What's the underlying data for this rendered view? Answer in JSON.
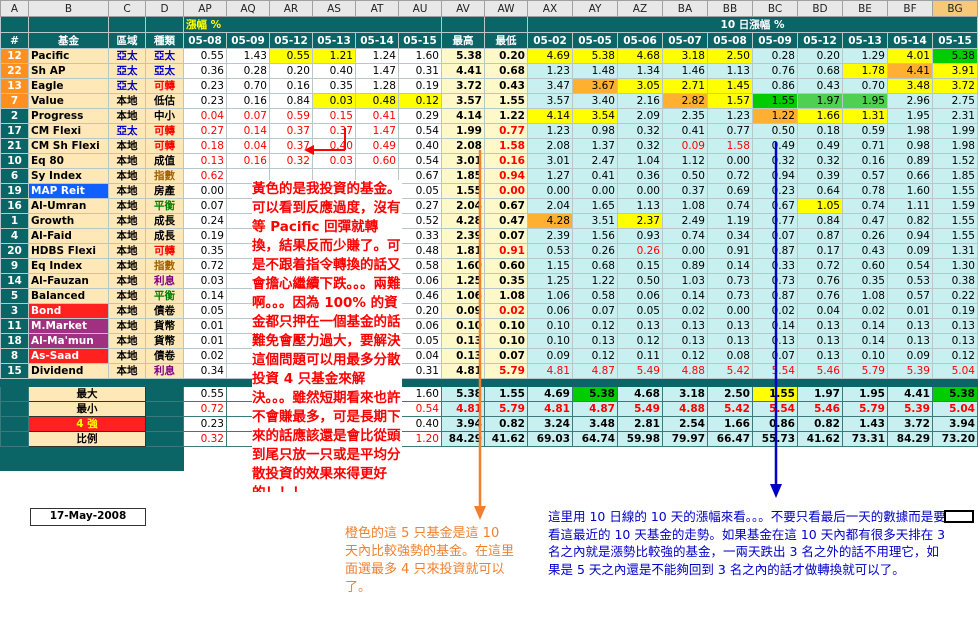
{
  "column_letters": [
    "A",
    "B",
    "C",
    "D",
    "AP",
    "AQ",
    "AR",
    "AS",
    "AT",
    "AU",
    "AV",
    "AW",
    "AX",
    "AY",
    "AZ",
    "BA",
    "BB",
    "BC",
    "BD",
    "BE",
    "BF",
    "BG"
  ],
  "header": {
    "change_label": "漲幅 %",
    "ten_day_label": "10 日漲幅 %",
    "row2": [
      "#",
      "基金",
      "區域",
      "種類",
      "05-08",
      "05-09",
      "05-12",
      "05-13",
      "05-14",
      "05-15",
      "最高",
      "最低",
      "05-02",
      "05-05",
      "05-06",
      "05-07",
      "05-08",
      "05-09",
      "05-12",
      "05-13",
      "05-14",
      "05-15"
    ]
  },
  "rows": [
    {
      "idx": "12",
      "name": "Pacific",
      "region": "亞太",
      "category": "亞太",
      "d": [
        "0.55",
        "1.43",
        "0.55",
        "1.21",
        "1.24",
        "1.60"
      ],
      "max": "5.38",
      "min": "0.20",
      "t": [
        "4.69",
        "5.38",
        "4.68",
        "3.18",
        "2.50",
        "0.28",
        "0.20",
        "1.29",
        "4.01",
        "5.38"
      ]
    },
    {
      "idx": "22",
      "name": "Sh AP",
      "region": "亞太",
      "category": "亞太",
      "d": [
        "0.36",
        "0.28",
        "0.20",
        "0.40",
        "1.47",
        "0.31"
      ],
      "max": "4.41",
      "min": "0.68",
      "t": [
        "1.23",
        "1.48",
        "1.34",
        "1.46",
        "1.13",
        "0.76",
        "0.68",
        "1.78",
        "4.41",
        "3.91"
      ]
    },
    {
      "idx": "13",
      "name": "Eagle",
      "region": "亞太",
      "category": "可轉",
      "d": [
        "0.23",
        "0.70",
        "0.16",
        "0.35",
        "1.28",
        "0.19"
      ],
      "max": "3.72",
      "min": "0.43",
      "t": [
        "3.47",
        "3.67",
        "3.05",
        "2.71",
        "1.45",
        "0.86",
        "0.43",
        "0.70",
        "3.48",
        "3.72"
      ]
    },
    {
      "idx": "7",
      "name": "Value",
      "region": "本地",
      "category": "低估",
      "d": [
        "0.23",
        "0.16",
        "0.84",
        "0.03",
        "0.48",
        "0.12"
      ],
      "max": "3.57",
      "min": "1.55",
      "t": [
        "3.57",
        "3.40",
        "2.16",
        "2.82",
        "1.57",
        "1.55",
        "1.97",
        "1.95",
        "2.96",
        "2.75"
      ]
    },
    {
      "idx": "2",
      "name": "Progress",
      "region": "本地",
      "category": "中小",
      "d": [
        "0.04",
        "0.07",
        "0.59",
        "0.15",
        "0.41",
        "0.29"
      ],
      "max": "4.14",
      "min": "1.22",
      "t": [
        "4.14",
        "3.54",
        "2.09",
        "2.35",
        "1.23",
        "1.22",
        "1.66",
        "1.31",
        "1.95",
        "2.31"
      ]
    },
    {
      "idx": "17",
      "name": "CM Flexi",
      "region": "亞太",
      "category": "可轉",
      "d": [
        "0.27",
        "0.14",
        "0.37",
        "0.37",
        "1.47",
        "0.54"
      ],
      "max": "1.99",
      "min": "0.77",
      "t": [
        "1.23",
        "0.98",
        "0.32",
        "0.41",
        "0.77",
        "0.50",
        "0.18",
        "0.59",
        "1.98",
        "1.99"
      ]
    },
    {
      "idx": "21",
      "name": "CM Sh Flexi",
      "region": "本地",
      "category": "可轉",
      "d": [
        "0.18",
        "0.04",
        "0.37",
        "0.40",
        "0.49",
        "0.40"
      ],
      "max": "2.08",
      "min": "1.58",
      "t": [
        "2.08",
        "1.37",
        "0.32",
        "0.09",
        "1.58",
        "0.49",
        "0.49",
        "0.71",
        "0.98",
        "1.98"
      ]
    },
    {
      "idx": "10",
      "name": "Eq 80",
      "region": "本地",
      "category": "成值",
      "d": [
        "0.13",
        "0.16",
        "0.32",
        "0.03",
        "0.60",
        "0.54"
      ],
      "max": "3.01",
      "min": "0.16",
      "t": [
        "3.01",
        "2.47",
        "1.04",
        "1.12",
        "0.00",
        "0.32",
        "0.32",
        "0.16",
        "0.89",
        "1.52"
      ]
    },
    {
      "idx": "6",
      "name": "Sy Index",
      "region": "本地",
      "category": "指數",
      "d": [
        "0.62",
        "",
        "",
        "",
        "",
        "0.67"
      ],
      "max": "1.85",
      "min": "0.94",
      "t": [
        "1.27",
        "0.41",
        "0.36",
        "0.50",
        "0.72",
        "0.94",
        "0.39",
        "0.57",
        "0.66",
        "1.85"
      ]
    },
    {
      "idx": "19",
      "name": "MAP Reit",
      "region": "本地",
      "category": "房產",
      "d": [
        "0.00",
        "",
        "",
        "",
        "",
        "0.05"
      ],
      "max": "1.55",
      "min": "0.00",
      "t": [
        "0.00",
        "0.00",
        "0.00",
        "0.37",
        "0.69",
        "0.23",
        "0.64",
        "0.78",
        "1.60",
        "1.55"
      ]
    },
    {
      "idx": "16",
      "name": "Al-Umran",
      "region": "本地",
      "category": "平衡",
      "d": [
        "0.07",
        "",
        "",
        "",
        "",
        "0.27"
      ],
      "max": "2.04",
      "min": "0.67",
      "t": [
        "2.04",
        "1.65",
        "1.13",
        "1.08",
        "0.74",
        "0.67",
        "1.05",
        "0.74",
        "1.11",
        "1.59"
      ]
    },
    {
      "idx": "1",
      "name": "Growth",
      "region": "本地",
      "category": "成長",
      "d": [
        "0.24",
        "",
        "",
        "",
        "",
        "0.52"
      ],
      "max": "4.28",
      "min": "0.47",
      "t": [
        "4.28",
        "3.51",
        "2.37",
        "2.49",
        "1.19",
        "0.77",
        "0.84",
        "0.47",
        "0.82",
        "1.55"
      ]
    },
    {
      "idx": "4",
      "name": "Al-Faid",
      "region": "本地",
      "category": "成長",
      "d": [
        "0.19",
        "",
        "",
        "",
        "",
        "0.33"
      ],
      "max": "2.39",
      "min": "0.07",
      "t": [
        "2.39",
        "1.56",
        "0.93",
        "0.74",
        "0.34",
        "0.07",
        "0.87",
        "0.26",
        "0.94",
        "1.55"
      ]
    },
    {
      "idx": "20",
      "name": "HDBS Flexi",
      "region": "本地",
      "category": "可轉",
      "d": [
        "0.35",
        "",
        "",
        "",
        "",
        "0.48"
      ],
      "max": "1.81",
      "min": "0.91",
      "t": [
        "0.53",
        "0.26",
        "0.26",
        "0.00",
        "0.91",
        "0.87",
        "0.17",
        "0.43",
        "0.09",
        "1.31"
      ]
    },
    {
      "idx": "9",
      "name": "Eq Index",
      "region": "本地",
      "category": "指數",
      "d": [
        "0.72",
        "",
        "",
        "",
        "",
        "0.58"
      ],
      "max": "1.60",
      "min": "0.60",
      "t": [
        "1.15",
        "0.68",
        "0.15",
        "0.89",
        "0.14",
        "0.33",
        "0.72",
        "0.60",
        "0.54",
        "1.30"
      ]
    },
    {
      "idx": "14",
      "name": "Al-Fauzan",
      "region": "本地",
      "category": "利息",
      "d": [
        "0.03",
        "",
        "",
        "",
        "",
        "0.06"
      ],
      "max": "1.25",
      "min": "0.35",
      "t": [
        "1.25",
        "1.22",
        "0.50",
        "1.03",
        "0.73",
        "0.73",
        "0.76",
        "0.35",
        "0.53",
        "0.38"
      ]
    },
    {
      "idx": "5",
      "name": "Balanced",
      "region": "本地",
      "category": "平衡",
      "d": [
        "0.14",
        "",
        "",
        "",
        "",
        "0.46"
      ],
      "max": "1.06",
      "min": "1.08",
      "t": [
        "1.06",
        "0.58",
        "0.06",
        "0.14",
        "0.73",
        "0.87",
        "0.76",
        "1.08",
        "0.57",
        "0.22"
      ]
    },
    {
      "idx": "3",
      "name": "Bond",
      "region": "本地",
      "category": "債卷",
      "d": [
        "0.05",
        "",
        "",
        "",
        "",
        "0.20"
      ],
      "max": "0.09",
      "min": "0.02",
      "t": [
        "0.06",
        "0.07",
        "0.05",
        "0.02",
        "0.00",
        "0.02",
        "0.04",
        "0.02",
        "0.01",
        "0.19"
      ]
    },
    {
      "idx": "11",
      "name": "M.Market",
      "region": "本地",
      "category": "貨幣",
      "d": [
        "0.01",
        "",
        "",
        "",
        "",
        "0.06"
      ],
      "max": "0.10",
      "min": "0.10",
      "t": [
        "0.10",
        "0.12",
        "0.13",
        "0.13",
        "0.13",
        "0.14",
        "0.13",
        "0.14",
        "0.13",
        "0.13"
      ]
    },
    {
      "idx": "18",
      "name": "Al-Ma'mun",
      "region": "本地",
      "category": "貨幣",
      "d": [
        "0.01",
        "",
        "",
        "",
        "",
        "0.05"
      ],
      "max": "0.13",
      "min": "0.10",
      "t": [
        "0.10",
        "0.13",
        "0.12",
        "0.13",
        "0.13",
        "0.13",
        "0.13",
        "0.14",
        "0.13",
        "0.13"
      ]
    },
    {
      "idx": "8",
      "name": "As-Saad",
      "region": "本地",
      "category": "債卷",
      "d": [
        "0.02",
        "",
        "",
        "",
        "",
        "0.04"
      ],
      "max": "0.13",
      "min": "0.07",
      "t": [
        "0.09",
        "0.12",
        "0.11",
        "0.12",
        "0.08",
        "0.07",
        "0.13",
        "0.10",
        "0.09",
        "0.12"
      ]
    },
    {
      "idx": "15",
      "name": "Dividend",
      "region": "本地",
      "category": "利息",
      "d": [
        "0.34",
        "",
        "",
        "",
        "",
        "0.31"
      ],
      "max": "4.81",
      "min": "5.79",
      "t": [
        "4.81",
        "4.87",
        "5.49",
        "4.88",
        "5.42",
        "5.54",
        "5.46",
        "5.79",
        "5.39",
        "5.04"
      ]
    }
  ],
  "summary": {
    "labels": [
      "最大",
      "最小",
      "4 強",
      "比例"
    ],
    "rows": [
      {
        "d": [
          "0.55",
          "",
          "",
          "",
          "",
          "1.60"
        ],
        "max": "5.38",
        "min": "1.55",
        "t": [
          "4.69",
          "5.38",
          "4.68",
          "3.18",
          "2.50",
          "1.55",
          "1.97",
          "1.95",
          "4.41",
          "5.38"
        ]
      },
      {
        "d": [
          "0.72",
          "",
          "",
          "",
          "",
          "0.54"
        ],
        "max": "4.81",
        "min": "5.79",
        "t": [
          "4.81",
          "4.87",
          "5.49",
          "4.88",
          "5.42",
          "5.54",
          "5.46",
          "5.79",
          "5.39",
          "5.04"
        ]
      },
      {
        "d": [
          "0.23",
          "",
          "",
          "",
          "",
          "0.40"
        ],
        "max": "3.94",
        "min": "0.82",
        "t": [
          "3.24",
          "3.48",
          "2.81",
          "2.54",
          "1.66",
          "0.86",
          "0.82",
          "1.43",
          "3.72",
          "3.94"
        ]
      },
      {
        "d": [
          "0.32",
          "",
          "",
          "",
          "",
          "1.20"
        ],
        "max": "84.29",
        "min": "41.62",
        "t": [
          "69.03",
          "64.74",
          "59.98",
          "79.97",
          "66.47",
          "55.73",
          "41.62",
          "73.31",
          "84.29",
          "73.20"
        ]
      }
    ]
  },
  "date": "17-May-2008",
  "annotations": {
    "red": "黃色的是我投資的基金。可以看到反應過度，沒有等 Pacific 回彈就轉換，結果反而少賺了。可是不跟着指令轉換的話又會擔心繼續下跌。。。兩難啊。。。因為 100% 的資金都只押在一個基金的話難免會壓力過大，要解決這個問題可以用最多分散投資 4 只基金來解決。。。雖然短期看來也許不會賺最多，可是長期下來的話應該還是會比從頭到尾只放一只或是平均分散投資的效果來得更好的！！！",
    "orange": "橙色的這 5 只基金是這 10 天內比較強勢的基金。在這里面選最多 4 只來投資就可以了。",
    "blue": "這里用 10 日線的 10 天的漲幅來看。。。不要只看最后一天的數據而是要看這最近的 10 天基金的走勢。如果基金在這 10 天內都有很多天排在 3 名之內就是漲勢比較強的基金，一兩天跌出 3 名之外的話不用理它，如果是 5 天之內還是不能夠回到 3 名之內的話才做轉換就可以了。"
  },
  "colors": {
    "header_teal": "#0b6466",
    "annot_red": "#ff0000",
    "annot_orange": "#f08030",
    "annot_blue": "#0000c8",
    "highlight_yellow": "#ffff00",
    "highlight_green": "#00cc00",
    "highlight_orange": "#ffb030"
  }
}
